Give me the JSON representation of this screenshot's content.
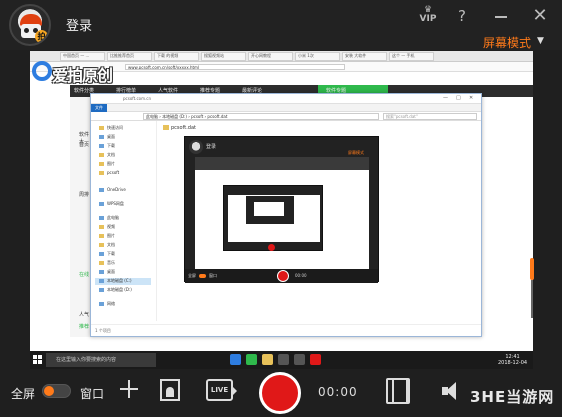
{
  "header": {
    "login_label": "登录",
    "vip_label": "VIP",
    "help_symbol": "?",
    "close_symbol": "✕",
    "mode_label": "屏幕模式",
    "avatar_badge": "拍"
  },
  "screen": {
    "browser_tabs": [
      "中国首页 — ...",
      "比推推荐首页",
      "下载 的视频",
      "搜狐视频站",
      "开心网教程",
      "小米 1次",
      "安装 大软件",
      "这个 — 手机"
    ],
    "url": "www.pcsoft.com.cn/soft/xxxxx.html",
    "logo_text": "爱拍原创",
    "site_nav": [
      "软件分类",
      "排行榜单",
      "人气软件",
      "推荐专题",
      "最新评论",
      "软件专题"
    ],
    "left_pane": [
      "软件大",
      "首页",
      "周排",
      "在线",
      "人气",
      "推荐"
    ],
    "explorer": {
      "path": "pcsoft.com.cn",
      "ribbon_file": "文件",
      "address": "此电脑 › 本地磁盘 (D:) › pcsoft › pcsoft.dat",
      "search_placeholder": "搜索\"pcsoft.dat\"",
      "nav_items": [
        "快速访问",
        "桌面",
        "下载",
        "文档",
        "图片",
        "pcsoft",
        "OneDrive",
        "WPS网盘",
        "此电脑",
        "视频",
        "图片",
        "文档",
        "下载",
        "音乐",
        "桌面",
        "本地磁盘 (C:)",
        "本地磁盘 (D:)",
        "网络"
      ],
      "file_name": "pcsoft.dat",
      "status": "1 个项目"
    },
    "nested_recorder": {
      "login_label": "登录",
      "mode_label": "屏幕模式",
      "timer": "00:00",
      "fullscreen_label": "全屏",
      "window_label": "窗口"
    },
    "taskbar": {
      "search_placeholder": "在这里输入你要搜索的内容",
      "time": "12:41",
      "date": "2018-12-04"
    }
  },
  "controls": {
    "fullscreen_label": "全屏",
    "window_label": "窗口",
    "live_label": "LIVE",
    "timer": "00:00"
  },
  "watermark": {
    "text": "3HE当游网"
  },
  "colors": {
    "accent": "#ff7a1a",
    "record_red": "#e01818",
    "background": "#1f1f1f"
  }
}
